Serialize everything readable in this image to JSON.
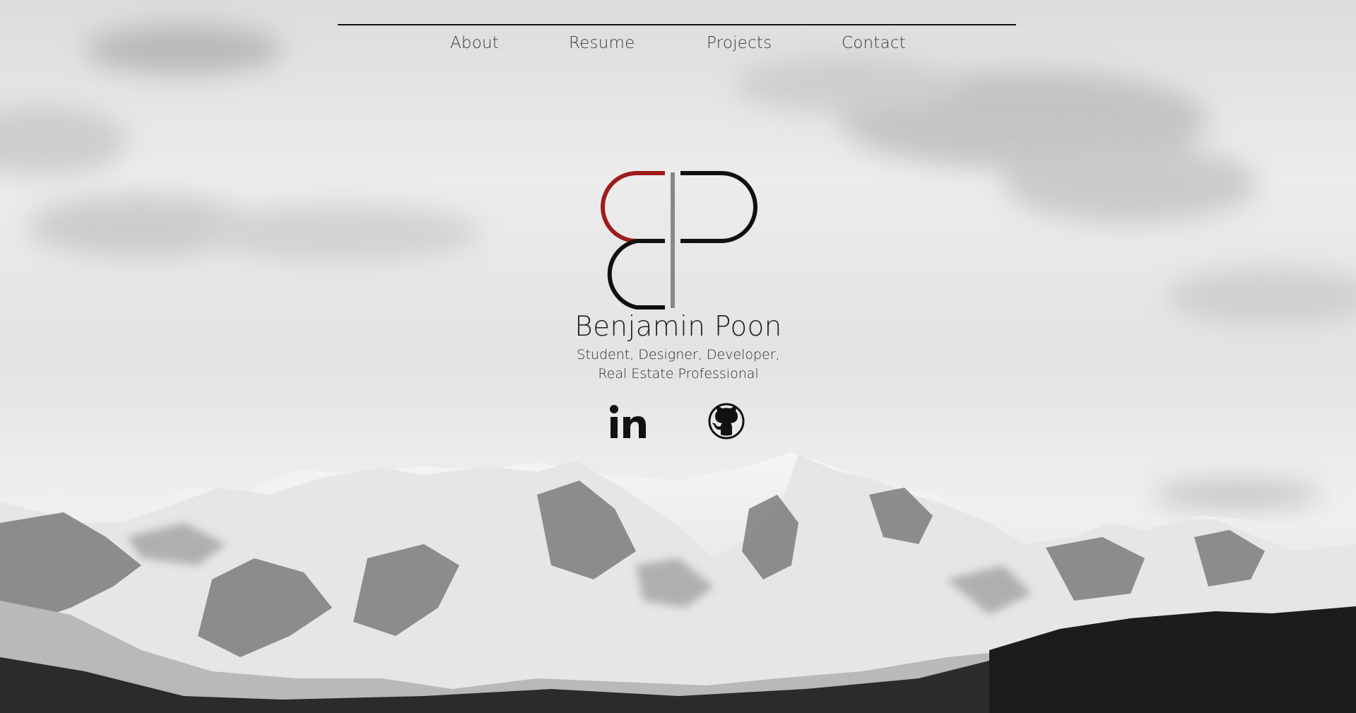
{
  "nav": {
    "items": [
      {
        "label": "About"
      },
      {
        "label": "Resume"
      },
      {
        "label": "Projects"
      },
      {
        "label": "Contact"
      }
    ]
  },
  "hero": {
    "name": "Benjamin Poon",
    "tagline_line1": "Student, Designer, Developer,",
    "tagline_line2": "Real Estate Professional",
    "logo_initials": "BP",
    "logo_accent_color": "#9e1b1b"
  },
  "social": [
    {
      "icon": "linkedin-icon"
    },
    {
      "icon": "github-icon"
    }
  ],
  "background": {
    "description_icon": "mountain-landscape",
    "tone": "grayscale"
  }
}
